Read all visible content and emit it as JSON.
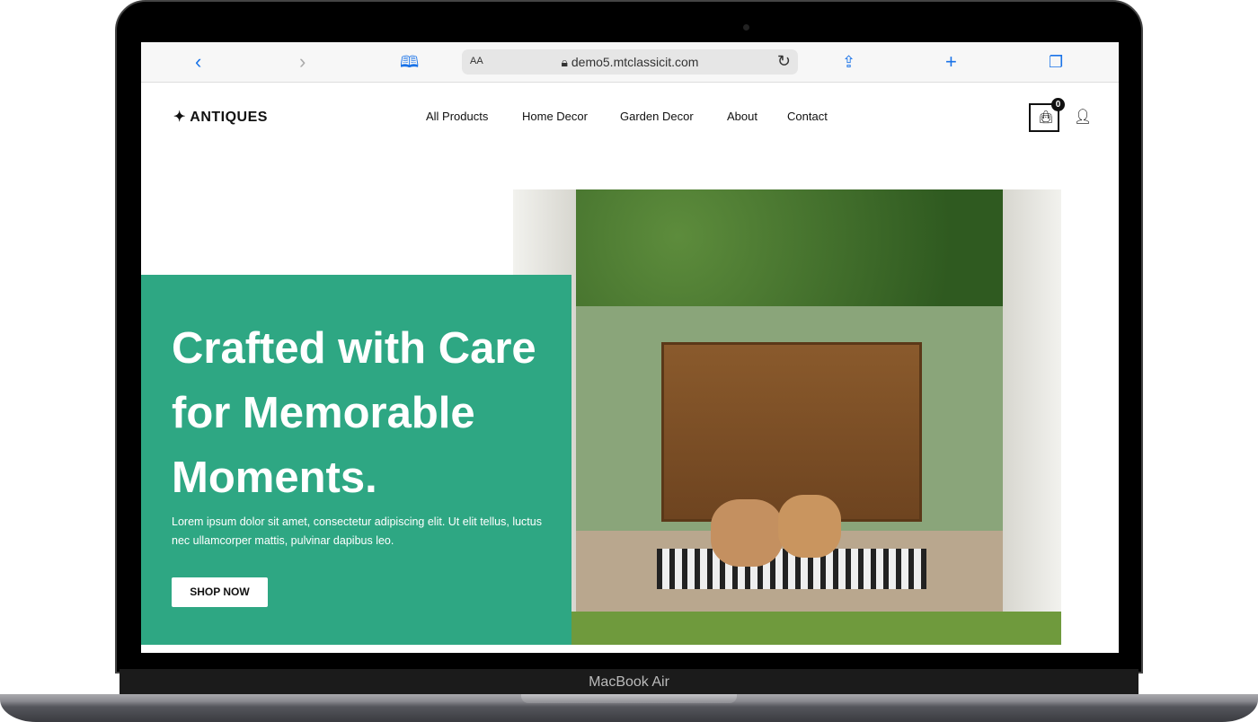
{
  "device": {
    "label": "MacBook Air"
  },
  "browser": {
    "text_size": "AA",
    "url": "demo5.mtclassicit.com",
    "icons": [
      "back-icon",
      "forward-icon",
      "bookmarks-icon",
      "lock-icon",
      "reload-icon",
      "share-icon",
      "new-tab-icon",
      "tabs-icon"
    ]
  },
  "site": {
    "logo": "ANTIQUES",
    "nav": [
      "All Products",
      "Home Decor",
      "Garden Decor",
      "About",
      "Contact"
    ],
    "cart_count": "0",
    "hero": {
      "title": "Crafted with Care for Memorable Moments.",
      "body": "Lorem ipsum dolor sit amet, consectetur adipiscing elit. Ut elit tellus, luctus nec ullamcorper mattis, pulvinar dapibus leo.",
      "cta": "SHOP NOW"
    },
    "colors": {
      "accent": "#2ea783"
    }
  }
}
